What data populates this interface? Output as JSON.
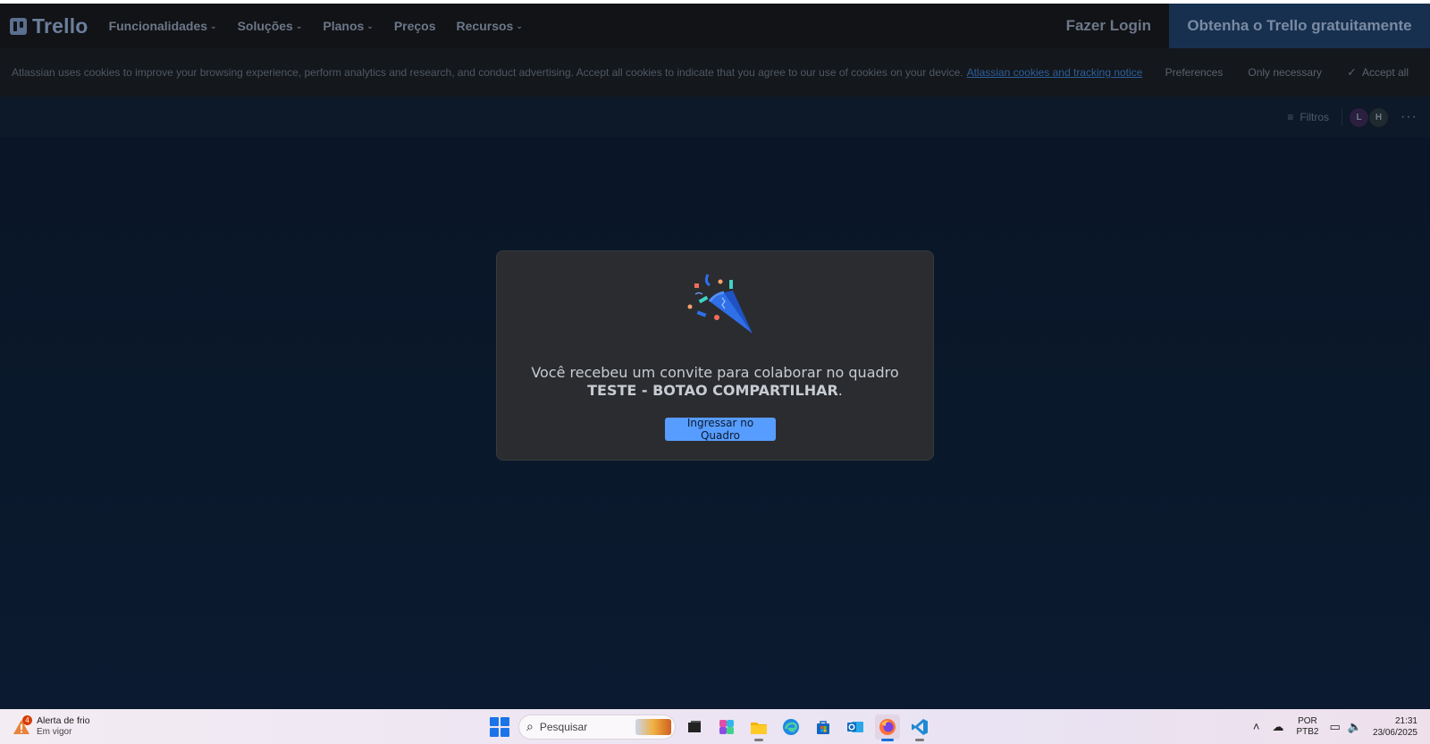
{
  "navbar": {
    "logo_text": "Trello",
    "items": [
      {
        "label": "Funcionalidades",
        "has_chevron": true
      },
      {
        "label": "Soluções",
        "has_chevron": true
      },
      {
        "label": "Planos",
        "has_chevron": true
      },
      {
        "label": "Preços",
        "has_chevron": false
      },
      {
        "label": "Recursos",
        "has_chevron": true
      }
    ],
    "login_label": "Fazer Login",
    "cta_label": "Obtenha o Trello gratuitamente"
  },
  "cookie_banner": {
    "text": "Atlassian uses cookies to improve your browsing experience, perform analytics and research, and conduct advertising. Accept all cookies to indicate that you agree to our use of cookies on your device.",
    "link_label": "Atlassian cookies and tracking notice",
    "preferences_label": "Preferences",
    "only_necessary_label": "Only necessary",
    "accept_all_label": "Accept all"
  },
  "board_header": {
    "filters_label": "Filtros",
    "avatars": [
      "L",
      "H"
    ],
    "more_icon": "ellipsis-icon"
  },
  "modal": {
    "message_prefix": "Você recebeu um convite para colaborar no quadro ",
    "board_name": "TESTE - BOTAO COMPARTILHAR",
    "message_suffix": ".",
    "join_button_label": "Ingressar no Quadro",
    "illustration_icon": "party-popper-icon"
  },
  "taskbar": {
    "weather_badge": "4",
    "weather_title": "Alerta de frio",
    "weather_subtitle": "Em vigor",
    "search_placeholder": "Pesquisar",
    "apps": [
      "task-view-icon",
      "copilot-icon",
      "file-explorer-icon",
      "edge-icon",
      "store-icon",
      "outlook-icon",
      "firefox-icon",
      "vscode-icon"
    ],
    "lang_top": "POR",
    "lang_bottom": "PTB2",
    "time": "21:31",
    "date": "23/06/2025"
  },
  "colors": {
    "accent_button": "#579dff",
    "background": "#0c1a2e",
    "modal_bg": "#2b2c2f"
  }
}
